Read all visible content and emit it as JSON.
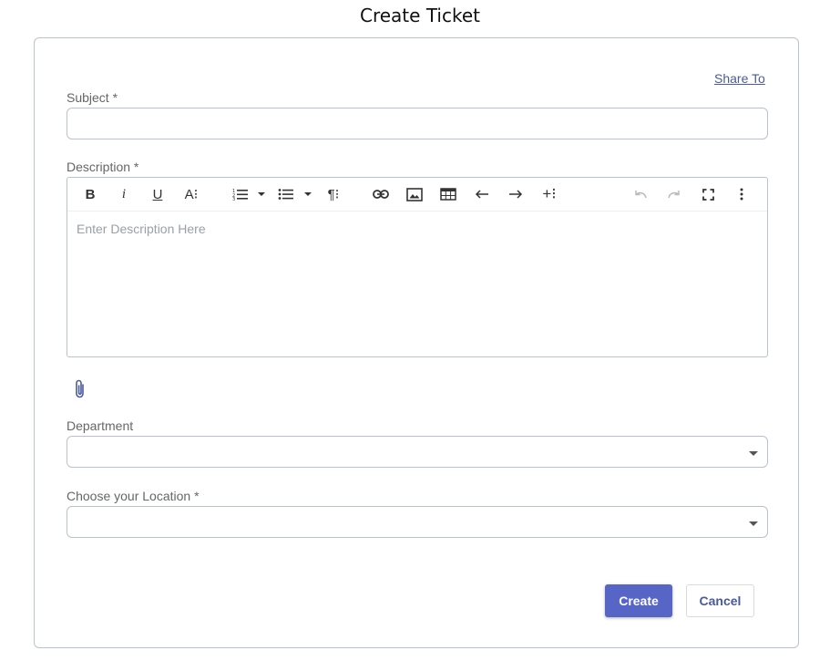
{
  "page": {
    "title": "Create Ticket"
  },
  "form": {
    "share_to": "Share To",
    "subject_label": "Subject *",
    "subject_value": "",
    "description_label": "Description *",
    "description_placeholder": "Enter Description Here",
    "department_label": "Department",
    "department_value": "",
    "location_label": "Choose your Location *",
    "location_value": ""
  },
  "toolbar": {
    "bold": "B",
    "italic": "i",
    "underline": "U",
    "font_size": "A⁝",
    "paragraph": "¶⁝",
    "insert_more": "+⁝",
    "icons": [
      "bold-icon",
      "italic-icon",
      "underline-icon",
      "font-size-icon",
      "ordered-list-icon",
      "unordered-list-icon",
      "paragraph-format-icon",
      "link-icon",
      "image-icon",
      "table-icon",
      "outdent-icon",
      "indent-icon",
      "insert-more-icon",
      "undo-icon",
      "redo-icon",
      "fullscreen-icon",
      "more-icon"
    ]
  },
  "actions": {
    "create": "Create",
    "cancel": "Cancel"
  },
  "colors": {
    "primary": "#5765c7",
    "border": "#b8c2d0",
    "link": "#4a5a9a"
  }
}
